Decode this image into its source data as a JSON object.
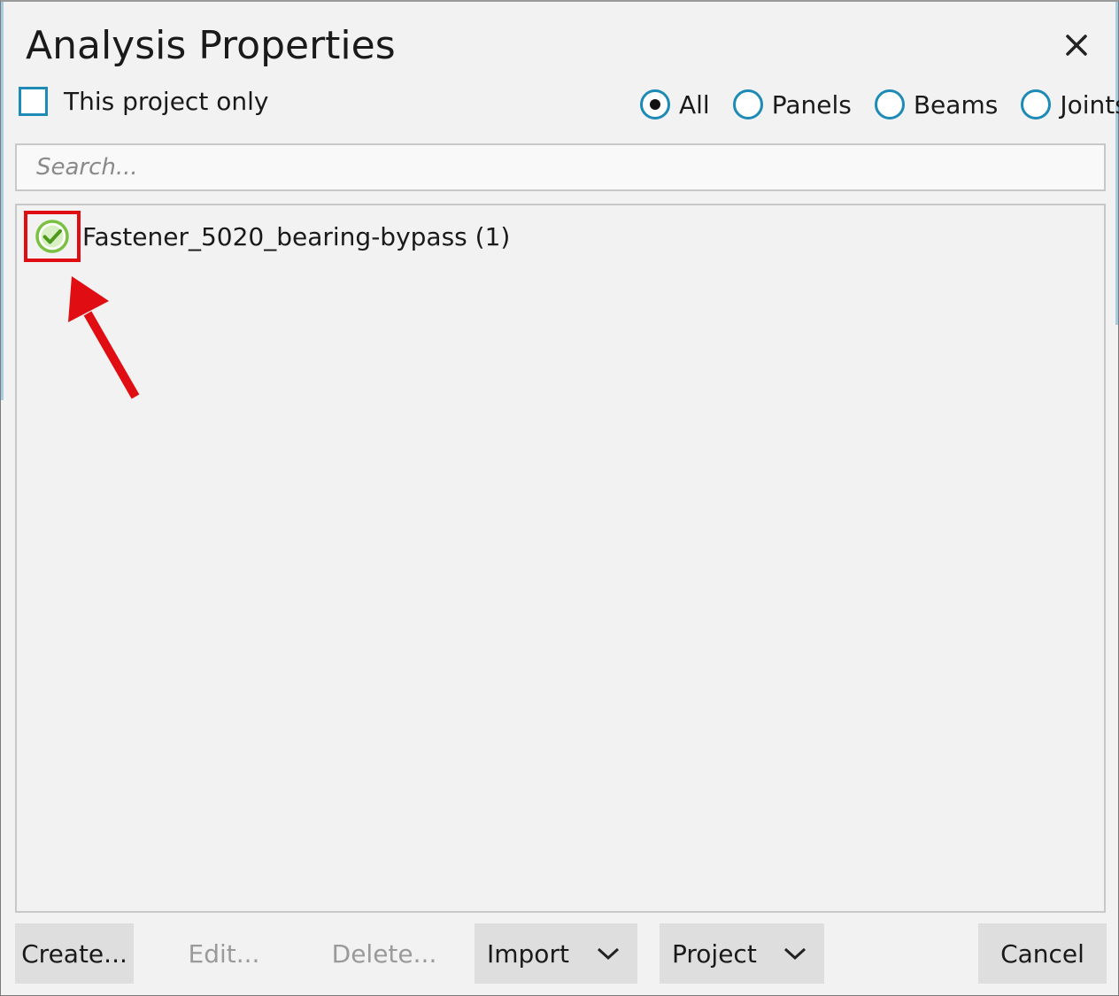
{
  "dialog": {
    "title": "Analysis Properties",
    "close_icon": "close-icon"
  },
  "filter": {
    "project_only_label": "This project only",
    "project_only_checked": false,
    "radios": [
      {
        "label": "All",
        "selected": true
      },
      {
        "label": "Panels",
        "selected": false
      },
      {
        "label": "Beams",
        "selected": false
      },
      {
        "label": "Joints",
        "selected": false
      }
    ]
  },
  "search": {
    "placeholder": "Search...",
    "value": ""
  },
  "list": {
    "items": [
      {
        "label": "Fastener_5020_bearing-bypass (1)",
        "status_icon": "check-circle-icon",
        "status_color": "#7ac143"
      }
    ]
  },
  "annotation": {
    "highlight_color": "#e00d12",
    "arrow_icon": "red-arrow-icon"
  },
  "buttons": {
    "create": "Create...",
    "edit": "Edit...",
    "delete": "Delete...",
    "import": "Import",
    "project": "Project",
    "cancel": "Cancel"
  },
  "colors": {
    "accent": "#1d8bb6",
    "background": "#f2f2f2",
    "button_bg": "#dedede",
    "disabled_text": "#9a9a9a"
  }
}
